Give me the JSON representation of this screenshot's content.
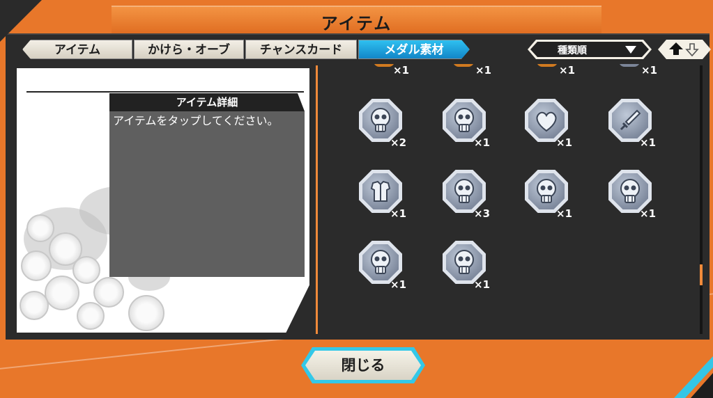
{
  "header": {
    "title": "アイテム"
  },
  "tabs": [
    {
      "label": "アイテム",
      "active": false
    },
    {
      "label": "かけら・オーブ",
      "active": false
    },
    {
      "label": "チャンスカード",
      "active": false
    },
    {
      "label": "メダル素材",
      "active": true
    }
  ],
  "sort": {
    "label": "種類順"
  },
  "detail": {
    "heading": "アイテム詳細",
    "message": "アイテムをタップしてください。"
  },
  "top_row_counts": [
    "×1",
    "×1",
    "×1",
    "×1"
  ],
  "medals": [
    {
      "icon": "skull-icon",
      "count": "×2"
    },
    {
      "icon": "skull-icon",
      "count": "×1"
    },
    {
      "icon": "heart-icon",
      "count": "×1"
    },
    {
      "icon": "sword-icon",
      "count": "×1"
    },
    {
      "icon": "armor-icon",
      "count": "×1"
    },
    {
      "icon": "skull-icon",
      "count": "×3"
    },
    {
      "icon": "skull-icon",
      "count": "×1"
    },
    {
      "icon": "skull-icon",
      "count": "×1"
    },
    {
      "icon": "skull-icon",
      "count": "×1"
    },
    {
      "icon": "skull-icon",
      "count": "×1"
    }
  ],
  "footer": {
    "close_label": "閉じる"
  },
  "colors": {
    "frame": "#e8772a",
    "active_tab": "#1a9ad8",
    "panel": "#2b2b2b"
  }
}
